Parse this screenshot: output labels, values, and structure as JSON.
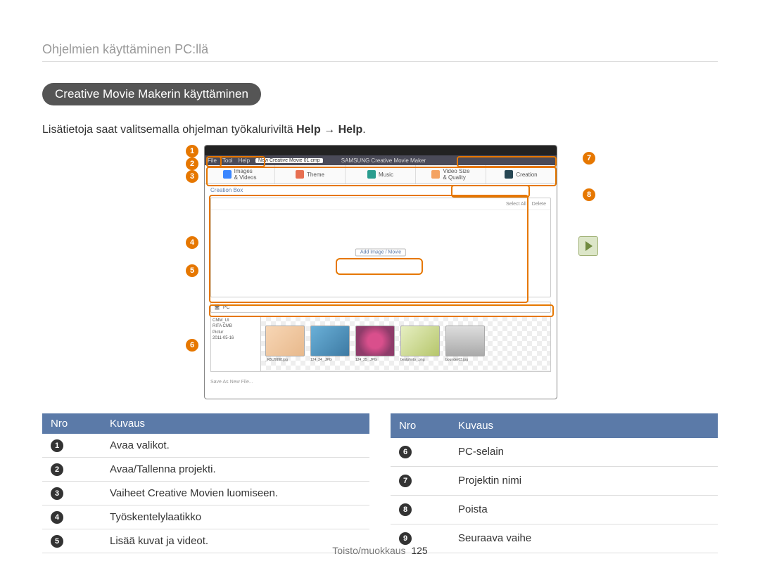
{
  "breadcrumb": "Ohjelmien käyttäminen PC:llä",
  "section_title": "Creative Movie Makerin käyttäminen",
  "intro_pre": "Lisätietoja saat valitsemalla ohjelman työkaluriviltä ",
  "intro_bold": "Help → Help",
  "intro_post": ".",
  "app": {
    "menu": {
      "file": "File",
      "tool": "Tool",
      "help": "Help"
    },
    "brand": "SAMSUNG  Creative Movie Maker",
    "project_chip": "New Creative Movie 01.cmp",
    "tabs": {
      "t1": "Images\n& Videos",
      "t2": "Theme",
      "t3": "Music",
      "t4": "Video Size\n& Quality",
      "t5": "Creation"
    },
    "creation_label": "Creation Box",
    "select_all": "Select All",
    "delete": "Delete",
    "add_btn": "Add Image / Movie",
    "pc_label": "PC",
    "tree": {
      "a": "CMM_UI",
      "b": "RITA CMB",
      "c": "Pictur",
      "d": "2011-05-16"
    },
    "thumbs": {
      "c1": "_R5U9998.jpg",
      "c2": "124_24_.JPG",
      "c3": "124_25_.JPG",
      "c4": "bestphoto_.png",
      "c5": "bounder03.jpg"
    },
    "save": "Save As New File..."
  },
  "table": {
    "h_nro": "Nro",
    "h_kuvaus": "Kuvaus",
    "r1": "Avaa valikot.",
    "r2": "Avaa/Tallenna projekti.",
    "r3": "Vaiheet Creative Movien luomiseen.",
    "r4": "Työskentelylaatikko",
    "r5": "Lisää kuvat ja videot.",
    "r6": "PC-selain",
    "r7": "Projektin nimi",
    "r8": "Poista",
    "r9": "Seuraava vaihe"
  },
  "nums": {
    "n1": "1",
    "n2": "2",
    "n3": "3",
    "n4": "4",
    "n5": "5",
    "n6": "6",
    "n7": "7",
    "n8": "8",
    "n9": "9"
  },
  "footer": {
    "section": "Toisto/muokkaus",
    "page": "125"
  }
}
